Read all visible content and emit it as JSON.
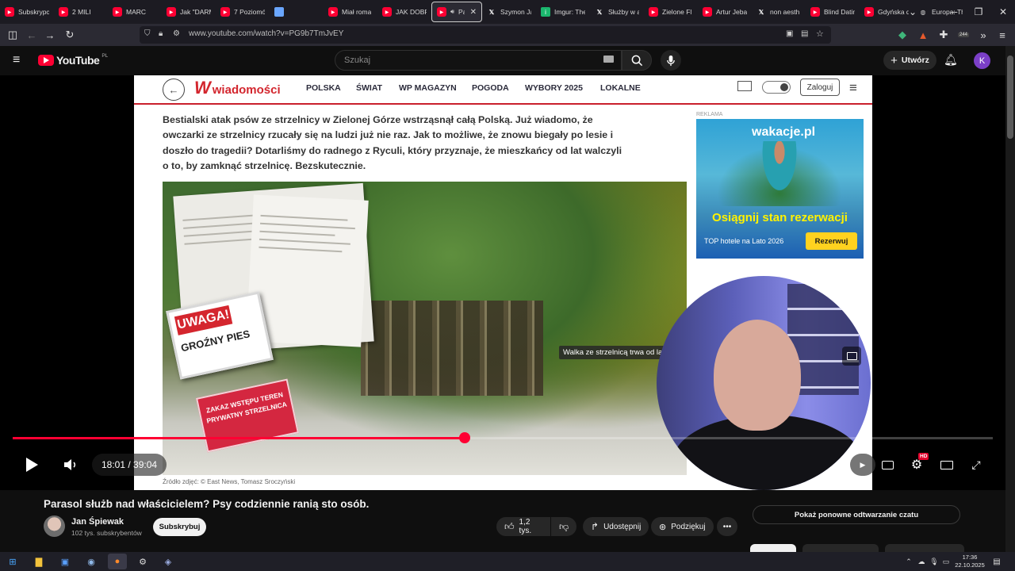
{
  "browser": {
    "tabs": [
      {
        "label": "Subskrypc",
        "icon": "youtube-icon"
      },
      {
        "label": "2 MILI",
        "icon": "youtube-icon"
      },
      {
        "label": "MARC",
        "icon": "youtube-icon"
      },
      {
        "label": "Jak \"DARM",
        "icon": "youtube-icon"
      },
      {
        "label": "7 Poziomó",
        "icon": "youtube-icon"
      },
      {
        "label": "",
        "icon": "blank-icon"
      },
      {
        "label": "Miał roma",
        "icon": "youtube-icon"
      },
      {
        "label": "JAK DOBR",
        "icon": "youtube-icon"
      },
      {
        "label": "Par",
        "icon": "youtube-icon",
        "active": true
      },
      {
        "label": "Szymon Ja",
        "icon": "x-icon"
      },
      {
        "label": "Imgur: The",
        "icon": "imgur-icon"
      },
      {
        "label": "Służby w a",
        "icon": "x-icon"
      },
      {
        "label": "Zielone Fl",
        "icon": "youtube-icon"
      },
      {
        "label": "Artur Jeba",
        "icon": "youtube-icon"
      },
      {
        "label": "non aesth",
        "icon": "x-icon"
      },
      {
        "label": "Blind Datin",
        "icon": "youtube-icon"
      },
      {
        "label": "Gdyńska d",
        "icon": "youtube-icon"
      },
      {
        "label": "Europa: Th",
        "icon": "globe-icon"
      }
    ],
    "url": "www.youtube.com/watch?v=PG9b7TmJvEY",
    "extension_badge": "244"
  },
  "youtube": {
    "logo": "YouTube",
    "region": "PL",
    "search_placeholder": "Szukaj",
    "create_label": "Utwórz",
    "avatar_letter": "K",
    "accent": "#ff0033"
  },
  "article": {
    "brand": "wiadomości",
    "nav": [
      "POLSKA",
      "ŚWIAT",
      "WP MAGAZYN",
      "POGODA",
      "WYBORY 2025",
      "LOKALNE"
    ],
    "login": "Zaloguj",
    "lead": "Bestialski atak psów ze strzelnicy w Zielonej Górze wstrząsnął całą Polską. Już wiadomo, że owczarki ze strzelnicy rzucały się na ludzi już nie raz. Jak to możliwe, że znowu biegały po lesie i doszło do tragedii? Dotarliśmy do radnego z Ryculi, który przyznaje, że mieszkańcy od lat walczyli o to, by zamknąć strzelnicę. Bezskutecznie.",
    "sign1_top": "UWAGA!",
    "sign1_bottom": "GROŹNY PIES",
    "sign2": "ZAKAZ WSTĘPU TEREN PRYWATNY STRZELNICA",
    "photo_caption": "Walka ze strzelnicą trwa od lat",
    "photo_source": "Źródło zdjęć: © East News, Tomasz Sroczyński",
    "ad_label": "REKLAMA",
    "ad_logo": "wakacje.pl",
    "ad_headline": "Osiągnij stan rezerwacji",
    "ad_sub": "TOP hotele na Lato 2026",
    "ad_button": "Rezerwuj"
  },
  "player": {
    "time": "18:01 / 39:04",
    "progress_fraction": 0.461,
    "hd_badge": "HD"
  },
  "video": {
    "title": "Parasol służb nad właścicielem? Psy codziennie ranią sto osób.",
    "channel": "Jan Śpiewak",
    "subscribers": "102 tys. subskrybentów",
    "subscribe_label": "Subskrybuj",
    "likes": "1,2 tys.",
    "share_label": "Udostępnij",
    "thanks_label": "Podziękuj",
    "chat_replay": "Pokaż ponowne odtwarzanie czatu"
  },
  "taskbar": {
    "time": "17:36",
    "date": "22.10.2025"
  }
}
